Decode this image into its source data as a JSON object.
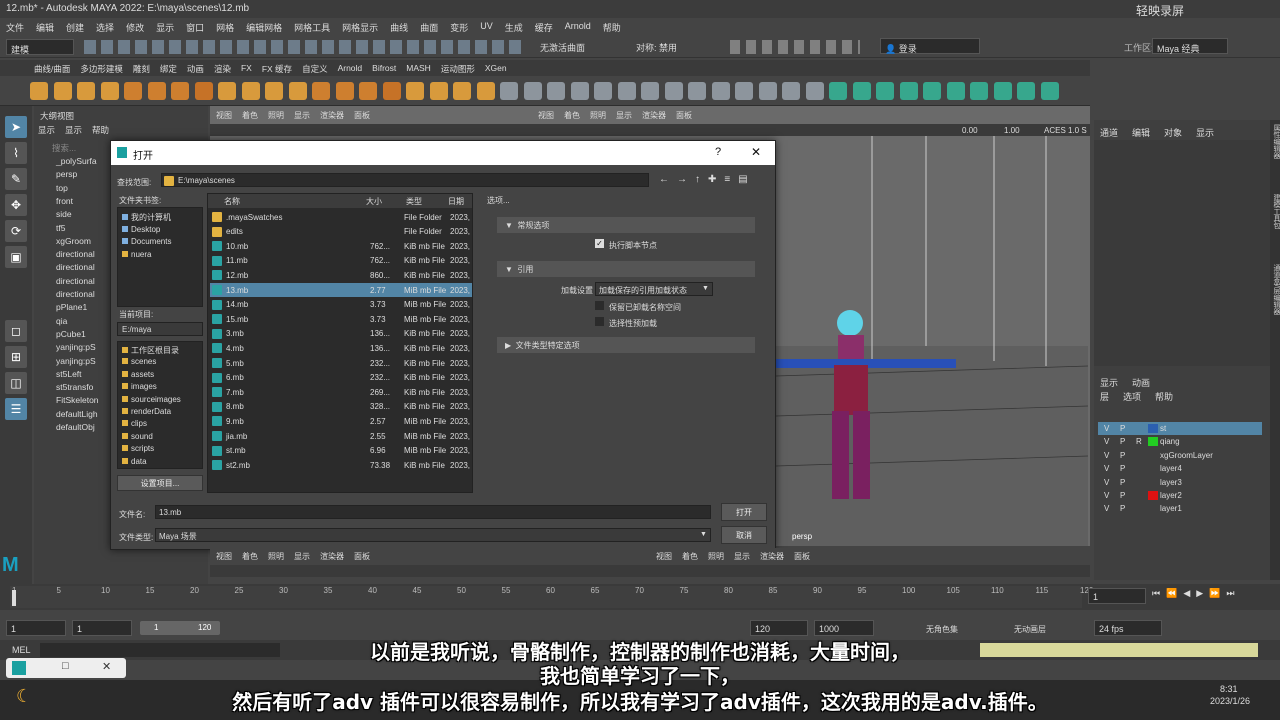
{
  "window": {
    "title": "12.mb* - Autodesk MAYA 2022: E:\\maya\\scenes\\12.mb",
    "watermark": "轻映录屏",
    "workspace_label": "工作区:",
    "workspace_value": "Maya 经典"
  },
  "menubar": [
    "文件",
    "编辑",
    "创建",
    "选择",
    "修改",
    "显示",
    "窗口",
    "网格",
    "编辑网格",
    "网格工具",
    "网格显示",
    "曲线",
    "曲面",
    "变形",
    "UV",
    "生成",
    "缓存",
    "Arnold",
    "帮助"
  ],
  "toolbar": {
    "mode_select": "建模",
    "live_surface": "无激活曲面",
    "symmetry": "对称: 禁用",
    "login": "登录"
  },
  "shelf_tabs": [
    "曲线/曲面",
    "多边形建模",
    "雕刻",
    "绑定",
    "动画",
    "渲染",
    "FX",
    "FX 缓存",
    "自定义",
    "Arnold",
    "Bifrost",
    "MASH",
    "运动图形",
    "XGen"
  ],
  "outliner": {
    "title": "大纲视图",
    "menu": [
      "显示",
      "显示",
      "帮助"
    ],
    "search": "搜索...",
    "items": [
      "_polySurfa",
      "persp",
      "top",
      "front",
      "side",
      "tf5",
      "xgGroom",
      "directional",
      "directional",
      "directional",
      "directional",
      "pPlane1",
      "qia",
      "pCube1",
      "yanjing:pS",
      "yanjing:pS",
      "st5Left",
      "st5transfo",
      "FitSkeleton",
      "defaultLigh",
      "defaultObj"
    ]
  },
  "viewport": {
    "menu": [
      "视图",
      "着色",
      "照明",
      "显示",
      "渲染器",
      "面板"
    ],
    "exposure": "0.00",
    "gamma": "1.00",
    "color_space": "ACES 1.0 S",
    "camera": "persp"
  },
  "channel_box": {
    "tabs": [
      "通道",
      "编辑",
      "对象",
      "显示"
    ],
    "layer_tabs": [
      "显示",
      "动画"
    ],
    "layer_menu": [
      "层",
      "选项",
      "帮助"
    ],
    "layers": [
      {
        "v": "V",
        "p": "P",
        "r": "",
        "name": "st",
        "color": "#2b5fb0",
        "selected": true
      },
      {
        "v": "V",
        "p": "P",
        "r": "R",
        "name": "qiang",
        "color": "#22cc22",
        "selected": false
      },
      {
        "v": "V",
        "p": "P",
        "r": "",
        "name": "xgGroomLayer",
        "color": "",
        "selected": false
      },
      {
        "v": "V",
        "p": "P",
        "r": "",
        "name": "layer4",
        "color": "",
        "selected": false
      },
      {
        "v": "V",
        "p": "P",
        "r": "",
        "name": "layer3",
        "color": "",
        "selected": false
      },
      {
        "v": "V",
        "p": "P",
        "r": "",
        "name": "layer2",
        "color": "#dd1111",
        "selected": false
      },
      {
        "v": "V",
        "p": "P",
        "r": "",
        "name": "layer1",
        "color": "",
        "selected": false
      }
    ]
  },
  "dialog": {
    "title": "打开",
    "help": "?",
    "close": "✕",
    "lookin_label": "查找范围:",
    "lookin_value": "E:\\maya\\scenes",
    "bookmarks_label": "文件夹书签:",
    "bookmarks": [
      "我的计算机",
      "Desktop",
      "Documents",
      "nuera"
    ],
    "project_label": "当前项目:",
    "project_value": "E:/maya",
    "project_folders": [
      "工作区根目录",
      "scenes",
      "assets",
      "images",
      "sourceimages",
      "renderData",
      "clips",
      "sound",
      "scripts",
      "data"
    ],
    "set_project": "设置项目...",
    "columns": [
      "名称",
      "大小",
      "类型",
      "日期"
    ],
    "files": [
      {
        "name": ".mayaSwatches",
        "size": "",
        "type": "File Folder",
        "date": "2023,",
        "kind": "folder"
      },
      {
        "name": "edits",
        "size": "",
        "type": "File Folder",
        "date": "2023,",
        "kind": "folder"
      },
      {
        "name": "10.mb",
        "size": "762...",
        "type": "KiB mb File",
        "date": "2023,",
        "kind": "mb"
      },
      {
        "name": "11.mb",
        "size": "762...",
        "type": "KiB mb File",
        "date": "2023,",
        "kind": "mb"
      },
      {
        "name": "12.mb",
        "size": "860...",
        "type": "KiB mb File",
        "date": "2023,",
        "kind": "mb"
      },
      {
        "name": "13.mb",
        "size": "2.77",
        "type": "MiB mb File",
        "date": "2023,",
        "kind": "mb",
        "selected": true
      },
      {
        "name": "14.mb",
        "size": "3.73",
        "type": "MiB mb File",
        "date": "2023,",
        "kind": "mb"
      },
      {
        "name": "15.mb",
        "size": "3.73",
        "type": "MiB mb File",
        "date": "2023,",
        "kind": "mb"
      },
      {
        "name": "3.mb",
        "size": "136...",
        "type": "KiB mb File",
        "date": "2023,",
        "kind": "mb"
      },
      {
        "name": "4.mb",
        "size": "136...",
        "type": "KiB mb File",
        "date": "2023,",
        "kind": "mb"
      },
      {
        "name": "5.mb",
        "size": "232...",
        "type": "KiB mb File",
        "date": "2023,",
        "kind": "mb"
      },
      {
        "name": "6.mb",
        "size": "232...",
        "type": "KiB mb File",
        "date": "2023,",
        "kind": "mb"
      },
      {
        "name": "7.mb",
        "size": "269...",
        "type": "KiB mb File",
        "date": "2023,",
        "kind": "mb"
      },
      {
        "name": "8.mb",
        "size": "328...",
        "type": "KiB mb File",
        "date": "2023,",
        "kind": "mb"
      },
      {
        "name": "9.mb",
        "size": "2.57",
        "type": "MiB mb File",
        "date": "2023,",
        "kind": "mb"
      },
      {
        "name": "jia.mb",
        "size": "2.55",
        "type": "MiB mb File",
        "date": "2023,",
        "kind": "mb"
      },
      {
        "name": "st.mb",
        "size": "6.96",
        "type": "MiB mb File",
        "date": "2023,",
        "kind": "mb"
      },
      {
        "name": "st2.mb",
        "size": "73.38",
        "type": "KiB mb File",
        "date": "2023,",
        "kind": "mb"
      }
    ],
    "options_label": "选项...",
    "sec_general": "常规选项",
    "exec_script": "执行脚本节点",
    "sec_reference": "引用",
    "load_settings_label": "加载设置",
    "load_settings_value": "加载保存的引用加载状态",
    "keep_namespace": "保留已卸载名称空间",
    "selective_load": "选择性预加载",
    "sec_filetype": "文件类型特定选项",
    "filename_label": "文件名:",
    "filename_value": "13.mb",
    "filetype_label": "文件类型:",
    "filetype_value": "Maya 场景",
    "open_btn": "打开",
    "cancel_btn": "取消"
  },
  "timeline": {
    "ticks": [
      "1",
      "5",
      "10",
      "15",
      "20",
      "25",
      "30",
      "35",
      "40",
      "45",
      "50",
      "55",
      "60",
      "65",
      "70",
      "75",
      "80",
      "85",
      "90",
      "95",
      "100",
      "105",
      "110",
      "115",
      "120"
    ],
    "current_frame": "1"
  },
  "range": {
    "start": "1",
    "inner_start": "1",
    "slider_start": "1",
    "slider_end": "120",
    "end": "120",
    "anim_end": "1000",
    "char_set": "无角色集",
    "anim_layer": "无动画层",
    "fps": "24 fps"
  },
  "command_line": {
    "label": "MEL"
  },
  "subtitles": [
    "以前是我听说，骨骼制作，控制器的制作也消耗，大量时间，",
    "我也简单学习了一下，",
    "然后有听了adv 插件可以很容易制作，所以我有学习了adv插件，这次我用的是adv.插件。"
  ],
  "side_tabs": [
    "属性编辑器",
    "建模工具包",
    "通道盒/层编辑器"
  ],
  "taskbar": {
    "time": "8:31",
    "date": "2023/1/26"
  }
}
